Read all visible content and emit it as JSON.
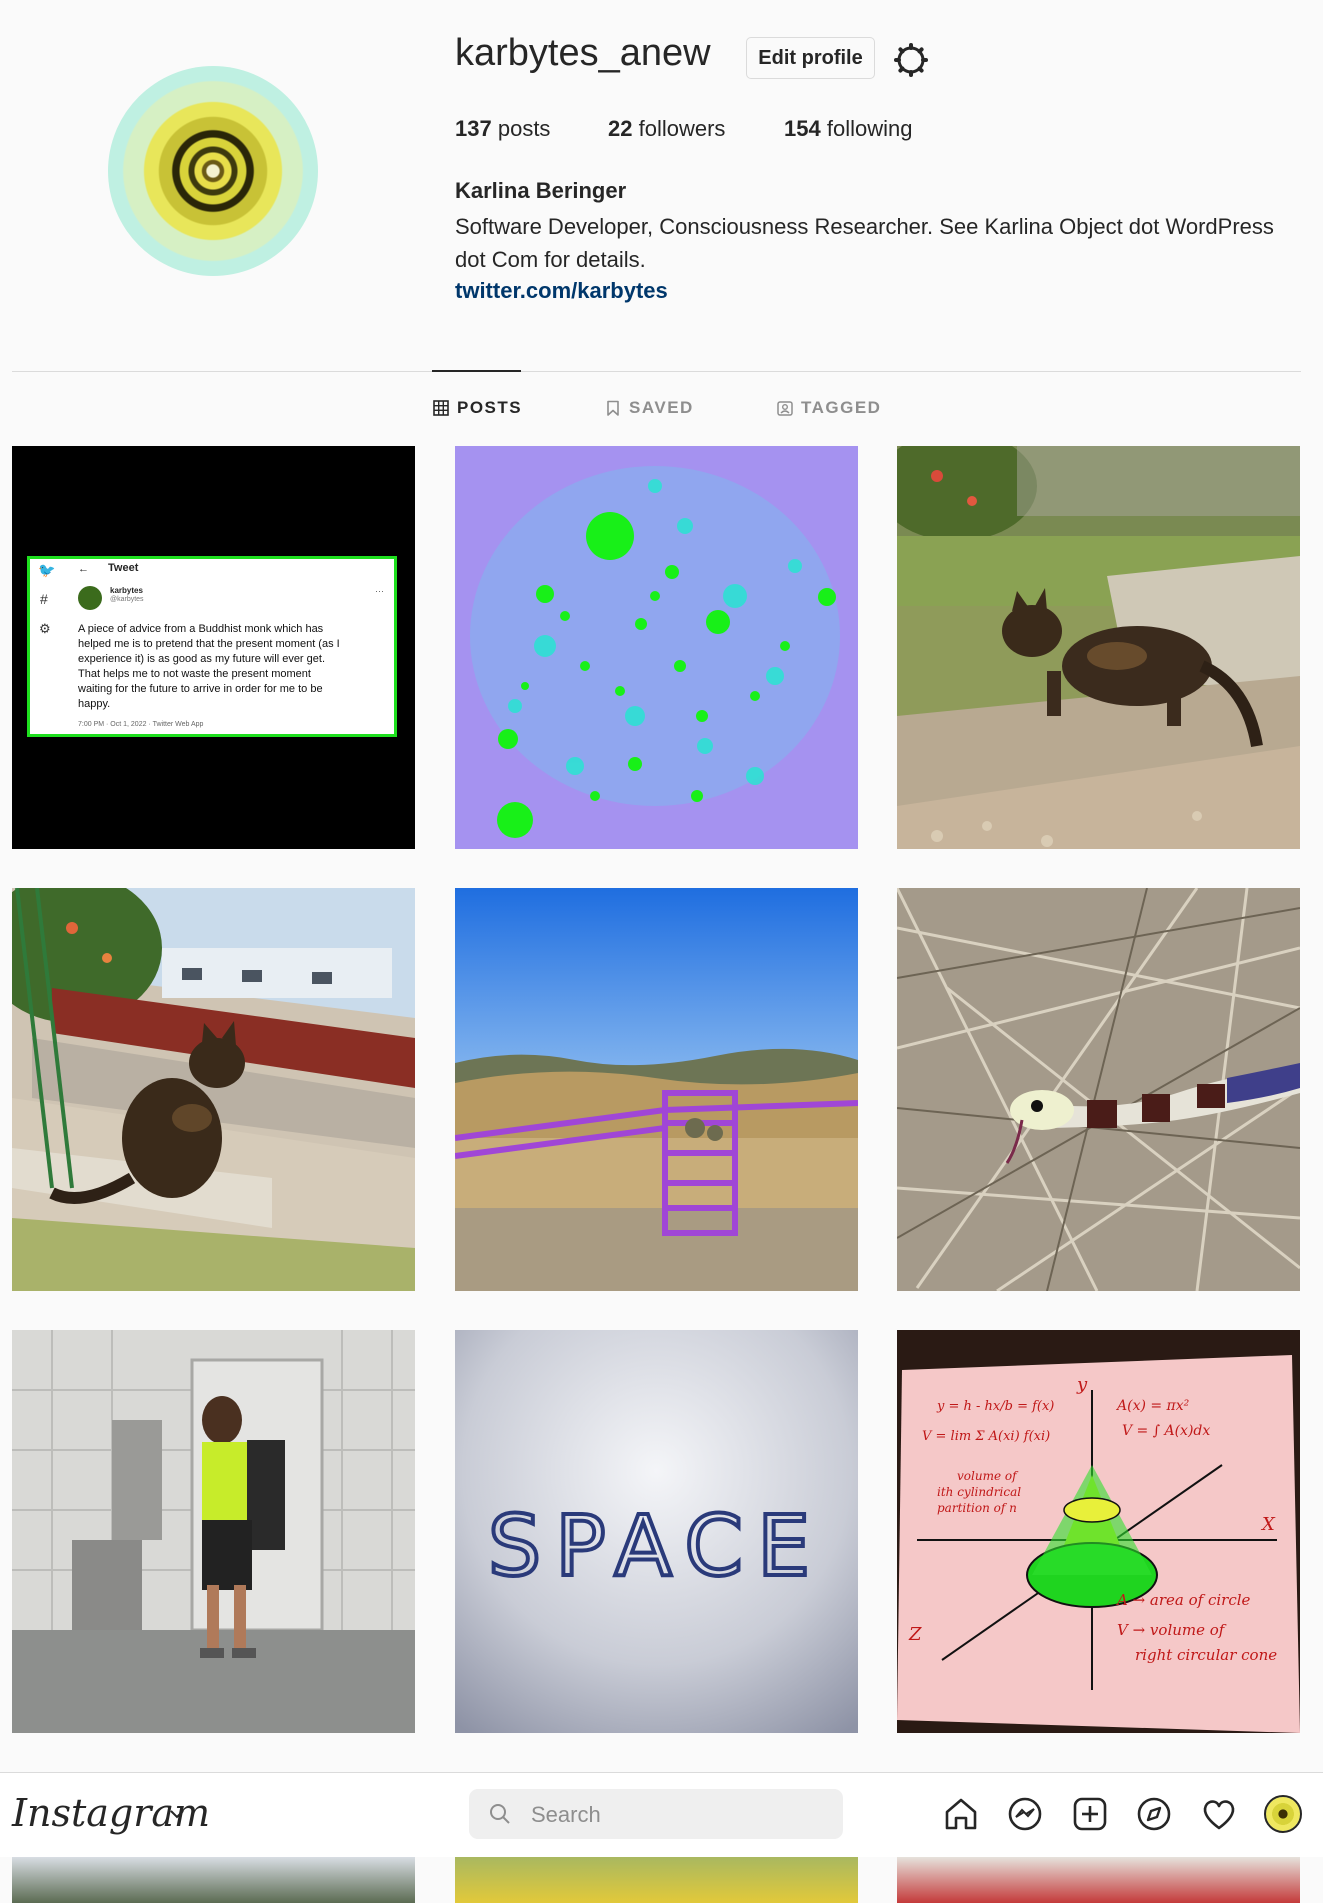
{
  "profile": {
    "username": "karbytes_anew",
    "edit_button": "Edit profile",
    "stats": {
      "posts_count": "137",
      "posts_label": "posts",
      "followers_count": "22",
      "followers_label": "followers",
      "following_count": "154",
      "following_label": "following"
    },
    "full_name": "Karlina Beringer",
    "bio": "Software Developer, Consciousness Researcher. See Karlina Object dot WordPress dot Com for details.",
    "link": "twitter.com/karbytes"
  },
  "tabs": [
    {
      "label": "POSTS",
      "icon": "grid-icon",
      "active": true
    },
    {
      "label": "SAVED",
      "icon": "bookmark-icon",
      "active": false
    },
    {
      "label": "TAGGED",
      "icon": "tag-user-icon",
      "active": false
    }
  ],
  "posts": {
    "tweet": {
      "header": "Tweet",
      "name": "karbytes",
      "handle": "@karbytes",
      "text_lines": [
        "A piece of advice from a Buddhist monk which has",
        "helped me is to pretend that the present moment (as I",
        "experience it) is as good as my future will ever get.",
        "That helps me to not waste the present moment",
        "waiting for the future to arrive in order for me to be",
        "happy."
      ],
      "meta": "7:00 PM · Oct 1, 2022 · Twitter Web App"
    },
    "space_word": "SPACE",
    "math_note": {
      "lines": [
        "y = h - hx/b = f(x)",
        "V = lim Σ A(xi) f(xi)",
        "volume of",
        "ith cylindrical",
        "partition of n",
        "A(x) = πx²",
        "V = ∫ A(x)dx"
      ],
      "axis_x": "X",
      "axis_y": "y",
      "axis_z": "Z",
      "legend_a": "A → area of circle",
      "legend_v1": "V → volume of",
      "legend_v2": "right circular cone"
    }
  },
  "bottom_bar": {
    "logo": "Instagram",
    "search_placeholder": "Search",
    "icons": [
      "home-icon",
      "messenger-icon",
      "new-post-icon",
      "explore-icon",
      "activity-heart-icon",
      "profile-avatar-icon"
    ]
  }
}
